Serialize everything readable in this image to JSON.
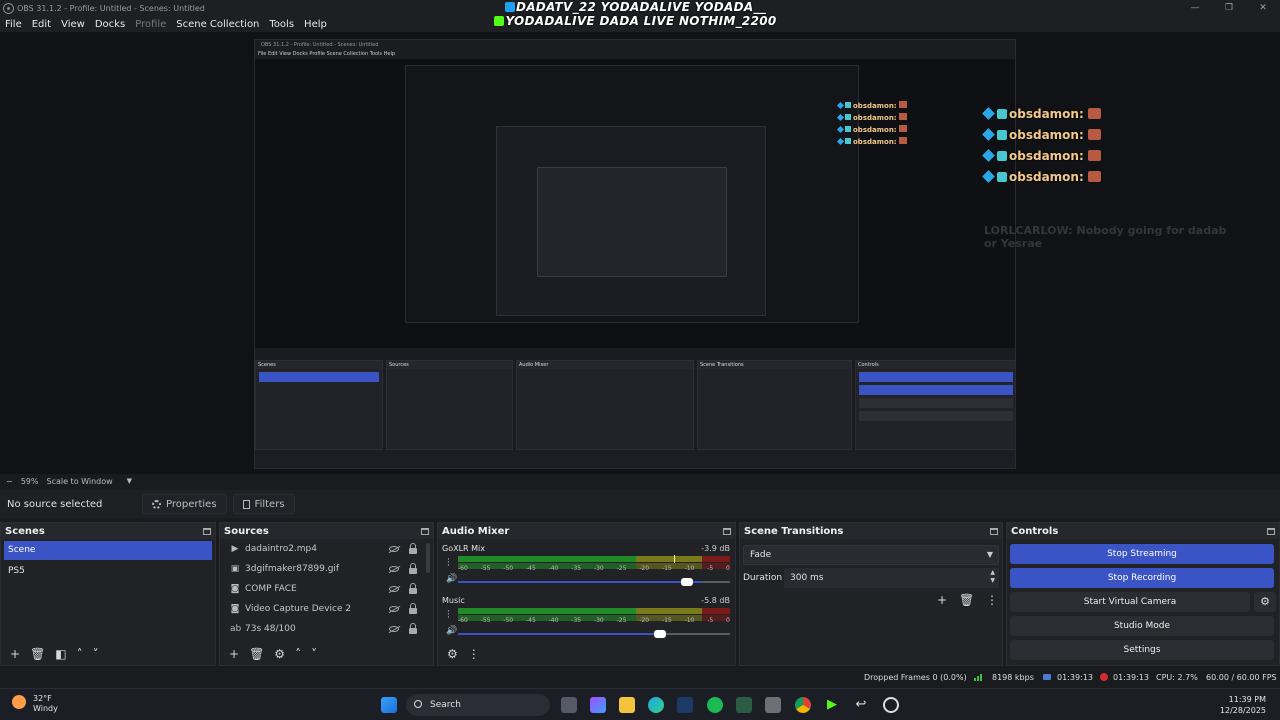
{
  "window": {
    "title": "OBS 31.1.2 - Profile: Untitled - Scenes: Untitled",
    "controls": [
      "—",
      "❐",
      "✕"
    ]
  },
  "menu": [
    "File",
    "Edit",
    "View",
    "Docks",
    "Profile",
    "Scene Collection",
    "Tools",
    "Help"
  ],
  "overlay": {
    "line1": "DADATV_22 YODADALIVE YODADA__",
    "line2": "YODADALIVE DADA LIVE NOTHIM_2200",
    "chat_messages": [
      "obsdamon:",
      "obsdamon:",
      "obsdamon:",
      "obsdamon:"
    ],
    "chat_faded": "LORLCARLOW: Nobody going for dadab or Yesrae"
  },
  "zoom": {
    "value": "59%",
    "mode": "Scale to Window"
  },
  "context": {
    "no_source": "No source selected",
    "properties": "Properties",
    "filters": "Filters"
  },
  "scenes": {
    "title": "Scenes",
    "items": [
      "Scene",
      "PS5"
    ]
  },
  "sources": {
    "title": "Sources",
    "items": [
      {
        "label": "dadaintro2.mp4",
        "icon": "play-icon"
      },
      {
        "label": "3dgifmaker87899.gif",
        "icon": "image-icon"
      },
      {
        "label": "COMP FACE",
        "icon": "camera-icon"
      },
      {
        "label": "Video Capture Device 2",
        "icon": "camera-icon"
      },
      {
        "label": "73s 48/100",
        "icon": "text-icon"
      }
    ]
  },
  "mixer": {
    "title": "Audio Mixer",
    "scale": [
      "-60",
      "-55",
      "-50",
      "-45",
      "-40",
      "-35",
      "-30",
      "-25",
      "-20",
      "-15",
      "-10",
      "-5",
      "0"
    ],
    "channels": [
      {
        "name": "GoXLR Mix",
        "db": "-3.9 dB",
        "volume": 0.84
      },
      {
        "name": "Music",
        "db": "-5.8 dB",
        "volume": 0.74
      }
    ]
  },
  "transitions": {
    "title": "Scene Transitions",
    "selected": "Fade",
    "duration_label": "Duration",
    "duration_value": "300 ms"
  },
  "controls": {
    "title": "Controls",
    "stop_streaming": "Stop Streaming",
    "stop_recording": "Stop Recording",
    "start_virtual_camera": "Start Virtual Camera",
    "studio_mode": "Studio Mode",
    "settings": "Settings"
  },
  "status": {
    "dropped": "Dropped Frames 0 (0.0%)",
    "bitrate": "8198 kbps",
    "stream_time": "01:39:13",
    "rec_time": "01:39:13",
    "cpu": "CPU: 2.7%",
    "fps": "60.00 / 60.00 FPS"
  },
  "taskbar": {
    "temp": "32°F",
    "condition": "Windy",
    "search": "Search",
    "time": "11:39 PM",
    "date": "12/28/2025"
  },
  "colors": {
    "accent": "#3b54c5",
    "meter_green": "#1f8a27",
    "chat_name": "#f3c98b"
  }
}
